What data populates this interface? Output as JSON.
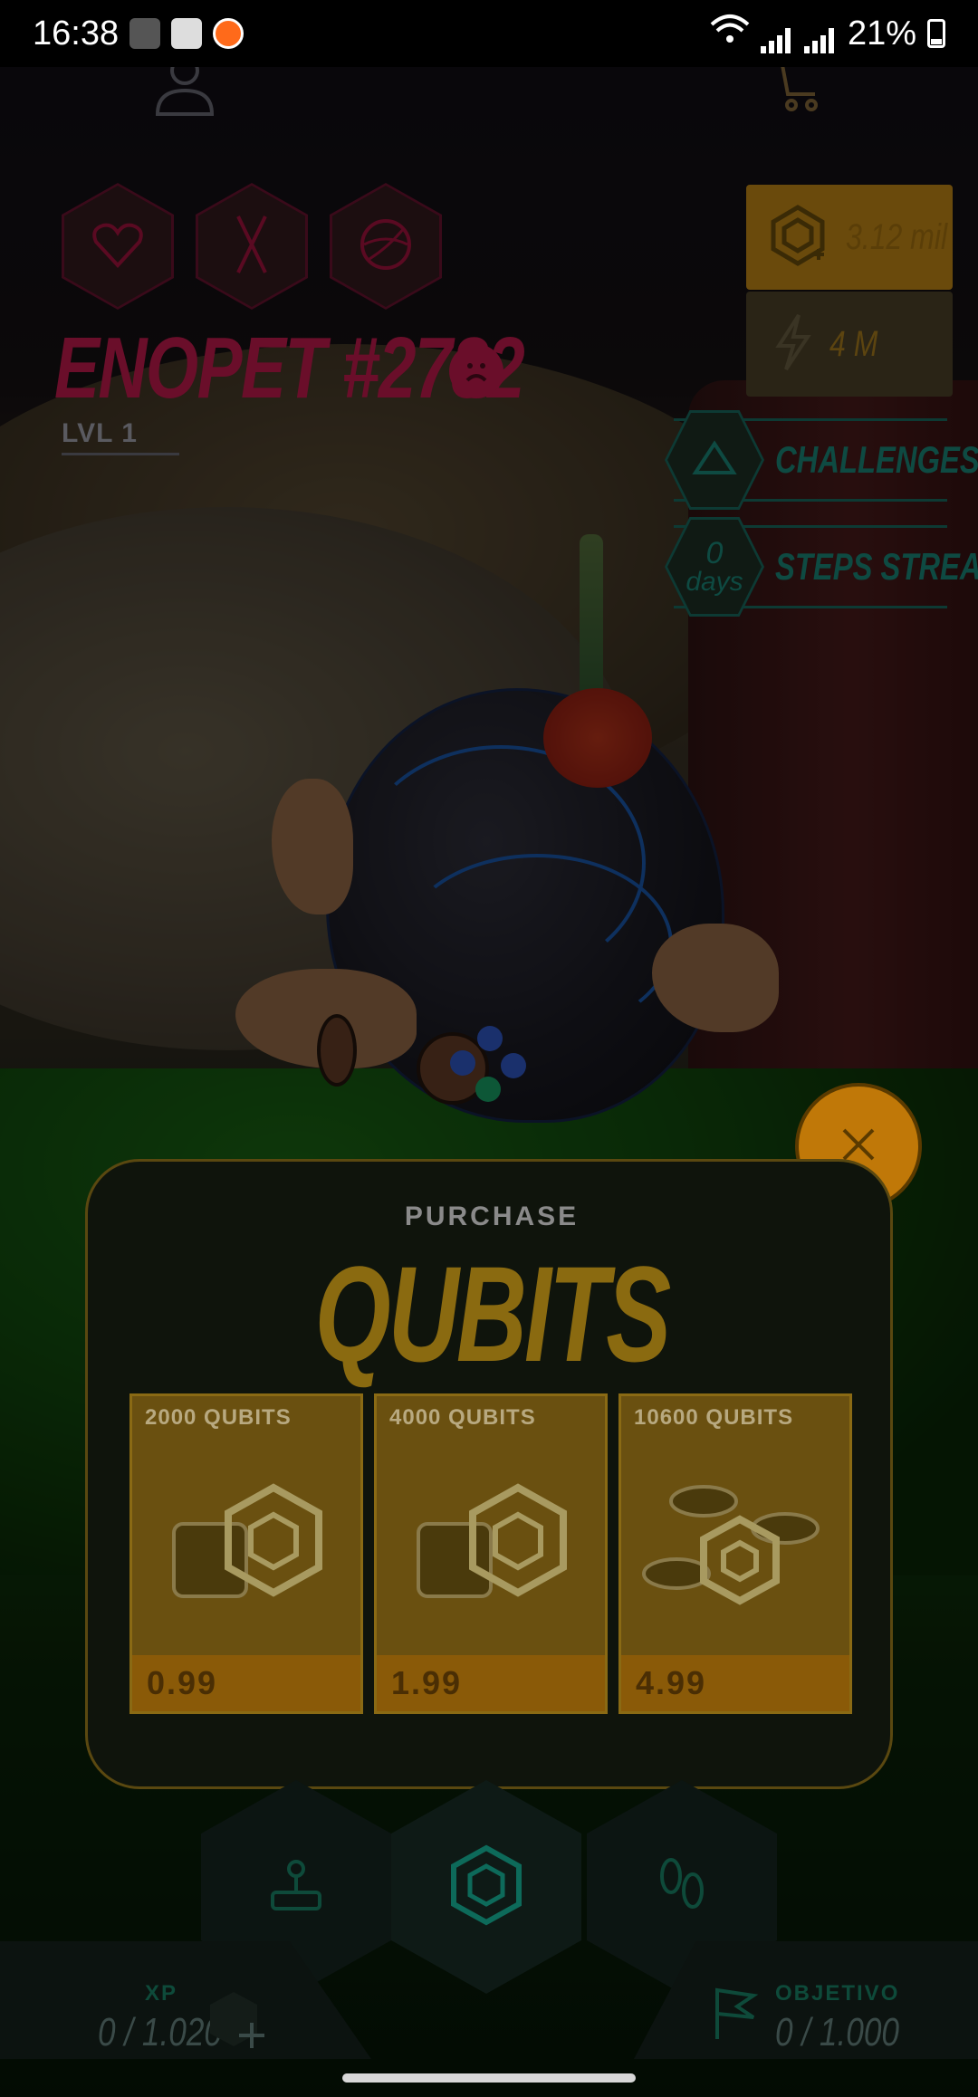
{
  "status_bar": {
    "time": "16:38",
    "battery": "21%"
  },
  "pet": {
    "name": "ENOPET #2782",
    "name_prefix_glyph": "¦",
    "level": "LVL 1"
  },
  "currencies": {
    "qubits": "3.12 mil",
    "energy": "4 M"
  },
  "side_buttons": {
    "challenges": "CHALLENGES",
    "steps_streak": "STEPS STREAK",
    "streak_count": "0",
    "streak_unit": "days"
  },
  "purchase": {
    "kicker": "PURCHASE",
    "title": "QUBITS",
    "packs": [
      {
        "label": "2000 QUBITS",
        "price": "0.99"
      },
      {
        "label": "4000 QUBITS",
        "price": "1.99"
      },
      {
        "label": "10600 QUBITS",
        "price": "4.99"
      }
    ]
  },
  "footer": {
    "xp_label": "XP",
    "xp_value": "0 / 1.020",
    "goal_label": "OBJETIVO",
    "goal_value": "0 / 1.000"
  },
  "colors": {
    "accent_gold": "#c07808",
    "hud_teal": "#0e4a42",
    "hud_crimson": "#6a0e2a"
  },
  "icons": [
    "profile-icon",
    "cart-icon",
    "heart-icon",
    "fork-knife-icon",
    "ball-icon",
    "sad-face-icon",
    "qubit-icon",
    "lightning-icon",
    "triangle-icon",
    "close-icon",
    "joystick-icon",
    "genopets-logo-icon",
    "footprints-icon",
    "flag-icon",
    "plus-icon"
  ]
}
